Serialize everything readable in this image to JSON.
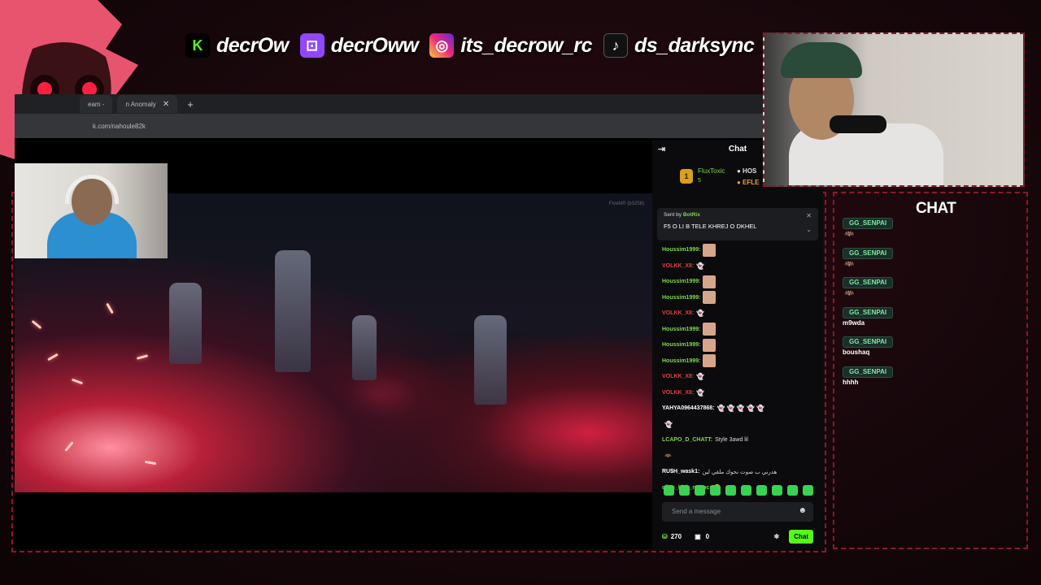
{
  "socials": [
    {
      "icon": "kick-icon",
      "glyph": "K",
      "color": "#53fc18",
      "text": "decrOw"
    },
    {
      "icon": "twitch-icon",
      "glyph": "⊡",
      "color": "#9146ff",
      "text": "decrOww"
    },
    {
      "icon": "instagram-icon",
      "glyph": "◎",
      "color": "#e1306c",
      "text": "its_decrow_rc"
    },
    {
      "icon": "tiktok-icon",
      "glyph": "♪",
      "color": "#111111",
      "text": "ds_darksync"
    }
  ],
  "browser": {
    "tab1": "eam -",
    "tab2": "n Anomaly",
    "close": "✕",
    "newtab": "+",
    "url": "k.com/nahoule82k",
    "star": "☆",
    "ext": "⧉"
  },
  "video": {
    "hud": "FiveM® (b3258)"
  },
  "kick_chat": {
    "header": "Chat",
    "menu": "⇥",
    "top_gifter": {
      "rank": "1",
      "name": "FluxToxic",
      "count": "5",
      "host": "● HOS",
      "eflex": "● EFLE"
    },
    "pinned": {
      "sent_prefix": "Sent by",
      "sender": "BotRix",
      "message": "F5 O LI B TELE KHREJ O DKHEL",
      "pin": "✕",
      "chev": "⌄"
    },
    "messages": [
      {
        "user": "Houssim1999:",
        "color": "#7fd650",
        "text": "",
        "kind": "emote"
      },
      {
        "user": "VOLKK_X8:",
        "color": "#e04040",
        "text": "👻",
        "kind": "ghost"
      },
      {
        "user": "Houssim1999:",
        "color": "#7fd650",
        "text": "",
        "kind": "emote"
      },
      {
        "user": "Houssim1999:",
        "color": "#7fd650",
        "text": "",
        "kind": "emote"
      },
      {
        "user": "VOLKK_X8:",
        "color": "#e04040",
        "text": "👻",
        "kind": "ghost"
      },
      {
        "user": "Houssim1999:",
        "color": "#7fd650",
        "text": "",
        "kind": "emote"
      },
      {
        "user": "Houssim1999:",
        "color": "#7fd650",
        "text": "",
        "kind": "emote"
      },
      {
        "user": "Houssim1999:",
        "color": "#7fd650",
        "text": "",
        "kind": "emote"
      },
      {
        "user": "VOLKK_X8:",
        "color": "#e04040",
        "text": "👻",
        "kind": "ghost"
      },
      {
        "user": "VOLKK_X8:",
        "color": "#e04040",
        "text": "👻",
        "kind": "ghost"
      },
      {
        "user": "YAHYA0964437868:",
        "color": "#ffffff",
        "text": "👻 👻 👻 👻 👻",
        "kind": "ghost"
      },
      {
        "user": "",
        "color": "#ffffff",
        "text": "👻",
        "kind": "ghost"
      },
      {
        "user": "LCAPO_D_CHATT:",
        "color": "#7fd650",
        "text": "Style 3awd lil",
        "kind": "text"
      },
      {
        "user": "",
        "color": "#e040c0",
        "text": "🦇",
        "kind": "text"
      },
      {
        "user": "RU$H_wask1:",
        "color": "#ffffff",
        "text": "هدرني ب صوت نحوك ملقي لين",
        "kind": "text"
      },
      {
        "user": "clips_kick_maroc:",
        "color": "#7fd650",
        "text": "😐",
        "kind": "text"
      }
    ],
    "input_placeholder": "Send a message",
    "smile": "☻",
    "points": "270",
    "points_icon": "⛁",
    "gift_icon": "▣",
    "gifts": "0",
    "gear": "✱",
    "chat_button": "Chat"
  },
  "overlay_chat": {
    "title": "CHAT",
    "entries": [
      {
        "user": "GG_SENPAI",
        "text": "🦇",
        "kind": "bat"
      },
      {
        "user": "GG_SENPAI",
        "text": "🦇",
        "kind": "bat"
      },
      {
        "user": "GG_SENPAI",
        "text": "🦇",
        "kind": "bat"
      },
      {
        "user": "GG_SENPAI",
        "text": "m9wda",
        "kind": "text"
      },
      {
        "user": "GG_SENPAI",
        "text": "boushaq",
        "kind": "text"
      },
      {
        "user": "GG_SENPAI",
        "text": "hhhh",
        "kind": "text"
      }
    ]
  }
}
